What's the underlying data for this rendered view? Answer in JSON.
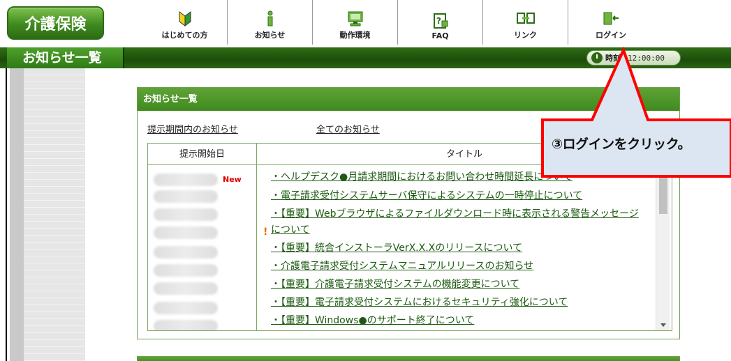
{
  "header": {
    "logo": "介護保険",
    "nav": [
      {
        "icon": "beginner-mark-icon",
        "label": "はじめての方"
      },
      {
        "icon": "info-icon",
        "label": "お知らせ"
      },
      {
        "icon": "monitor-icon",
        "label": "動作環境"
      },
      {
        "icon": "faq-icon",
        "label": "FAQ"
      },
      {
        "icon": "link-icon",
        "label": "リンク"
      },
      {
        "icon": "login-icon",
        "label": "ログイン"
      }
    ]
  },
  "titlebar": {
    "page_title": "お知らせ一覧",
    "clock_label": "時刻",
    "clock_time": "12:00:00"
  },
  "panel": {
    "heading": "お知らせ一覧",
    "tab_current": "提示期間内のお知らせ",
    "tab_all": "全てのお知らせ",
    "col_date": "提示開始日",
    "col_title": "タイトル",
    "new_badge": "New",
    "warn_mark": "!",
    "items": [
      "・ヘルプデスク●月請求期間におけるお問い合わせ時間延長について",
      "・電子請求受付システムサーバ保守によるシステムの一時停止について",
      "・【重要】Webブラウザによるファイルダウンロード時に表示される警告メッセージについて",
      "・【重要】統合インストーラVerX.X.Xのリリースについて",
      "・介護電子請求受付システムマニュアルリリースのお知らせ",
      "・【重要】介護電子請求受付システムの機能変更について",
      "・【重要】電子請求受付システムにおけるセキュリティ強化について",
      "・【重要】Windows●のサポート終了について"
    ]
  },
  "callout": {
    "text": "③ログインをクリック。",
    "border_color": "#ff0000",
    "fill_color": "#dce6f2"
  }
}
